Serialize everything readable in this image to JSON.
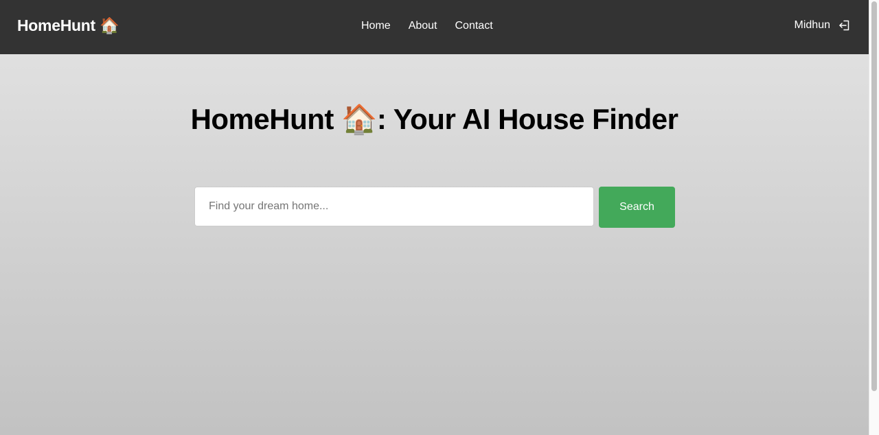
{
  "navbar": {
    "brand": "HomeHunt 🏠",
    "links": [
      "Home",
      "About",
      "Contact"
    ],
    "user_name": "Midhun",
    "logout_icon": "logout-icon"
  },
  "hero": {
    "title": "HomeHunt 🏠: Your AI House Finder"
  },
  "search": {
    "placeholder": "Find your dream home...",
    "value": "",
    "button_label": "Search"
  },
  "colors": {
    "navbar_bg": "#333333",
    "accent_green": "#43a95a"
  }
}
